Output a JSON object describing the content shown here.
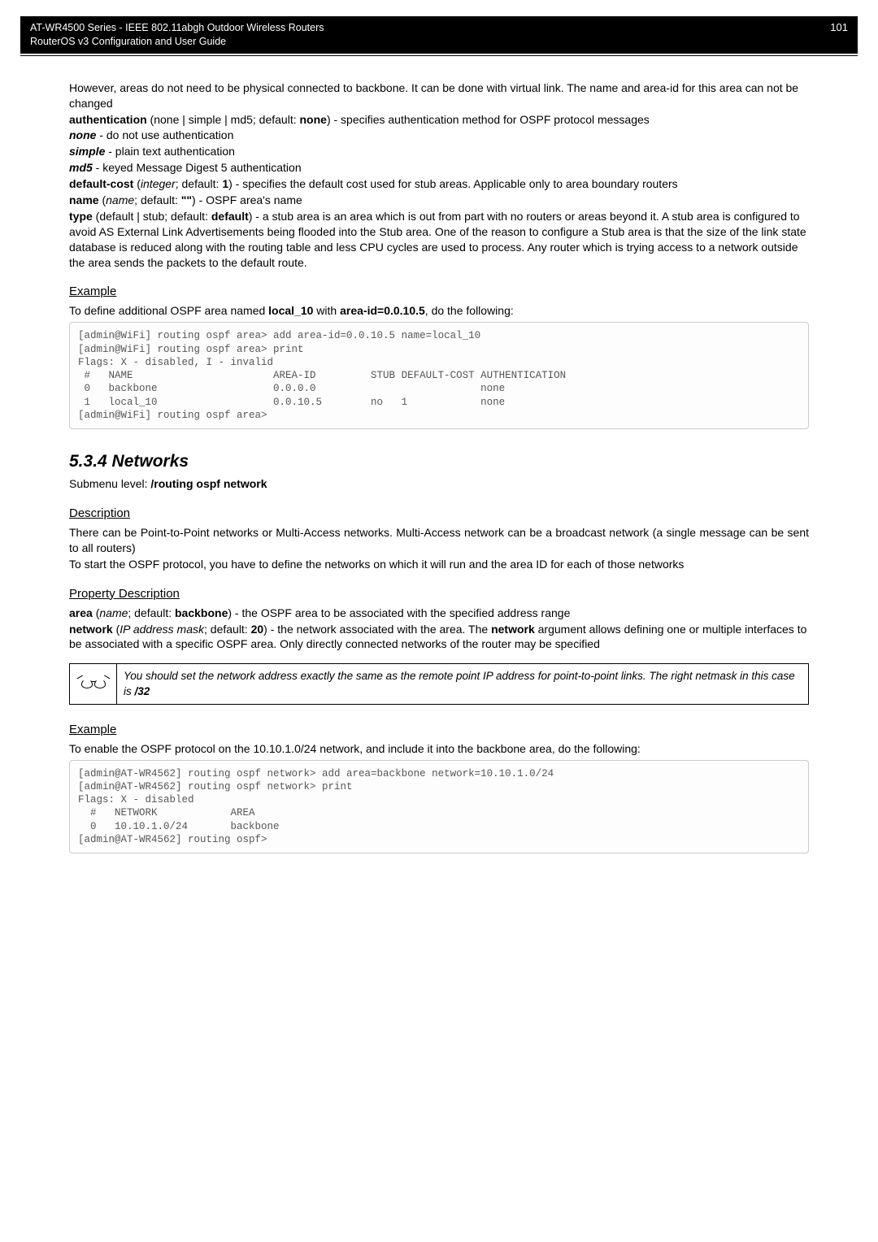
{
  "header": {
    "line1": "AT-WR4500 Series - IEEE 802.11abgh Outdoor Wireless Routers",
    "line2": "RouterOS v3 Configuration and User Guide",
    "page_num": "101"
  },
  "intro": {
    "p1": "However, areas do not need to be physical connected to backbone. It can be done with virtual link. The name and area-id for this area can not be changed",
    "auth_label": "authentication",
    "auth_rest": " (none | simple | md5; default: ",
    "auth_default": "none",
    "auth_tail": ") - specifies authentication method for OSPF protocol messages",
    "none_b": "none",
    "none_t": " - do not use authentication",
    "simple_b": "simple",
    "simple_t": " - plain text authentication",
    "md5_b": "md5",
    "md5_t": " - keyed Message Digest 5 authentication",
    "dc_b": "default-cost",
    "dc_rest": " (",
    "dc_i": "integer",
    "dc_rest2": "; default: ",
    "dc_def": "1",
    "dc_tail": ") - specifies the default cost used for stub areas. Applicable only to area boundary routers",
    "name_b": "name",
    "name_rest": " (",
    "name_i": "name",
    "name_rest2": "; default: ",
    "name_def": "\"\"",
    "name_tail": ") - OSPF area's name",
    "type_b": "type",
    "type_rest": " (default | stub; default: ",
    "type_def": "default",
    "type_tail": ") - a stub area is an area which is out from part with no routers or areas beyond it. A stub area is configured to avoid AS External Link Advertisements being flooded into the Stub area. One of the reason to configure a Stub area is that the size of the link state database is reduced along with the routing table and less CPU cycles are used to process. Any router which is trying access to a network outside the area sends the packets to the default route."
  },
  "example1": {
    "heading": "Example",
    "intro_pre": "To define additional OSPF area named ",
    "intro_b1": "local_10",
    "intro_mid": " with ",
    "intro_b2": "area-id=0.0.10.5",
    "intro_post": ", do the following:",
    "code": "[admin@WiFi] routing ospf area> add area-id=0.0.10.5 name=local_10\n[admin@WiFi] routing ospf area> print\nFlags: X - disabled, I - invalid\n #   NAME                       AREA-ID         STUB DEFAULT-COST AUTHENTICATION\n 0   backbone                   0.0.0.0                           none\n 1   local_10                   0.0.10.5        no   1            none\n[admin@WiFi] routing ospf area>"
  },
  "networks": {
    "heading": "5.3.4  Networks",
    "submenu_pre": "Submenu level: ",
    "submenu_b": "/routing ospf network",
    "desc_h": "Description",
    "desc_p1": "There can be Point-to-Point networks or Multi-Access networks. Multi-Access network can be a broadcast network (a single message can be sent to all routers)",
    "desc_p2": "To start the OSPF protocol, you have to define the networks on which it will run and the area ID for each of those networks",
    "prop_h": "Property Description",
    "area_b": "area",
    "area_rest": " (",
    "area_i": "name",
    "area_rest2": "; default: ",
    "area_def": "backbone",
    "area_tail": ") - the OSPF area to be associated with the specified address range",
    "net_b": "network",
    "net_rest": " (",
    "net_i": "IP address mask",
    "net_rest2": "; default: ",
    "net_def": "20",
    "net_tail1": ") - the network associated with the area. The ",
    "net_tail_b": "network",
    "net_tail2": " argument allows defining one or multiple interfaces to be associated with a specific OSPF area. Only directly connected networks of the router may be specified",
    "note_pre": "You should set the network address exactly the same as the remote point IP address for point-to-point links. The right netmask in this case is ",
    "note_b": "/32"
  },
  "example2": {
    "heading": "Example",
    "intro": "To enable the OSPF protocol on the 10.10.1.0/24 network, and include it into the backbone area, do the following:",
    "code": "[admin@AT-WR4562] routing ospf network> add area=backbone network=10.10.1.0/24\n[admin@AT-WR4562] routing ospf network> print\nFlags: X - disabled\n  #   NETWORK            AREA\n  0   10.10.1.0/24       backbone\n[admin@AT-WR4562] routing ospf>"
  }
}
